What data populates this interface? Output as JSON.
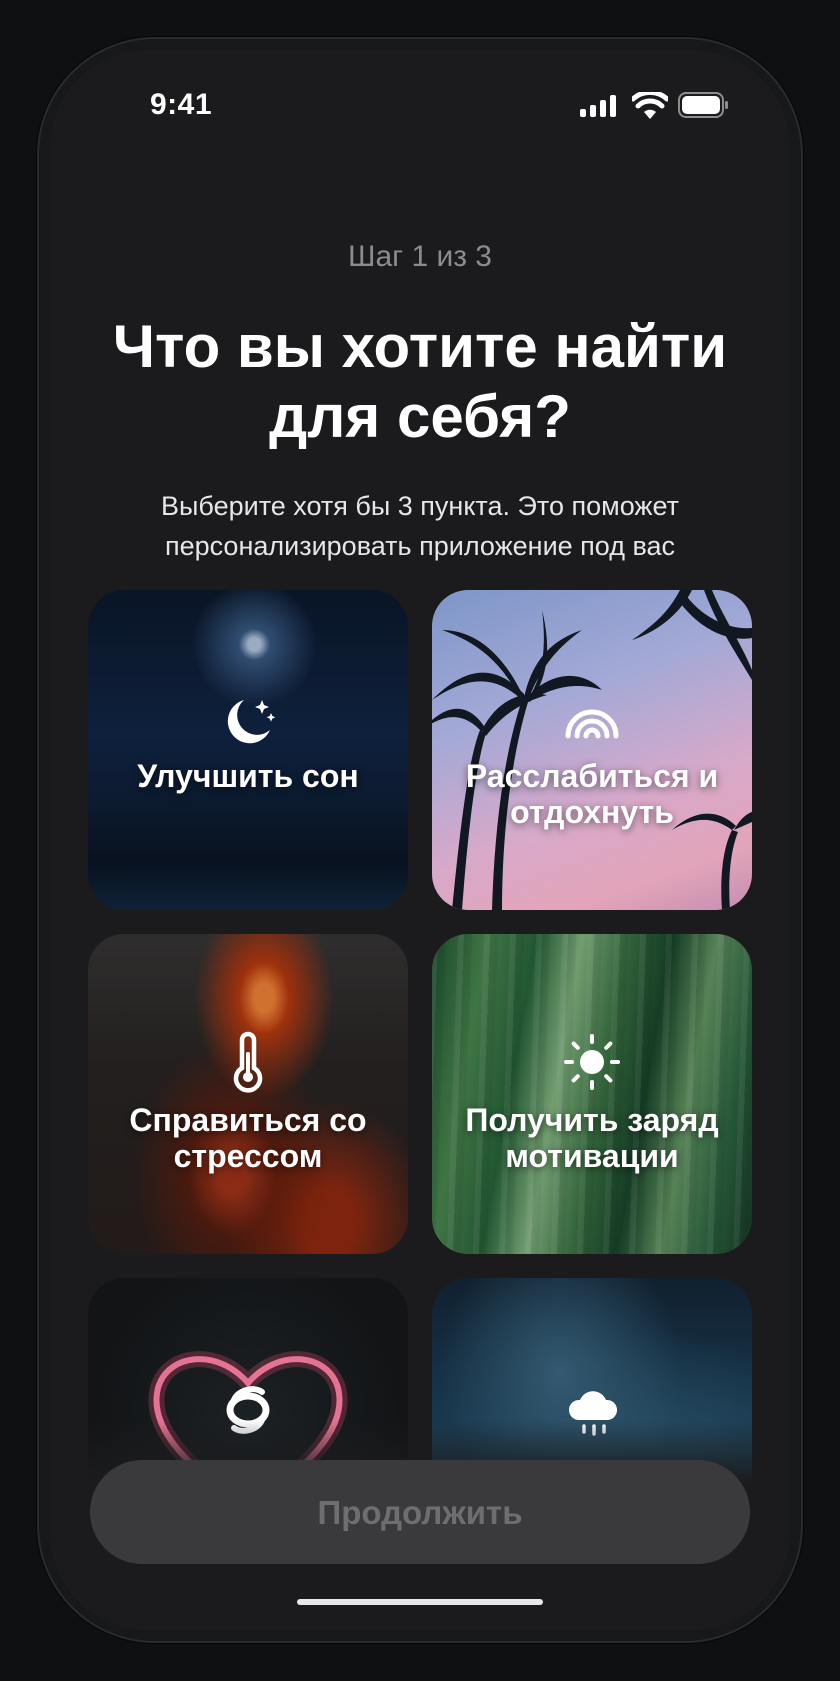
{
  "status_bar": {
    "time": "9:41"
  },
  "onboarding": {
    "step_label": "Шаг 1 из 3",
    "title": "Что вы хотите найти для себя?",
    "subtitle": "Выберите хотя бы 3 пункта. Это поможет персонализировать приложение под вас"
  },
  "goals": [
    {
      "label": "Улучшить сон",
      "icon": "moon-stars-icon"
    },
    {
      "label": "Расслабиться и отдохнуть",
      "icon": "rainbow-icon"
    },
    {
      "label": "Справиться со стрессом",
      "icon": "thermometer-icon"
    },
    {
      "label": "Получить заряд мотивации",
      "icon": "sun-icon"
    },
    {
      "label": "",
      "icon": "swirl-icon"
    },
    {
      "label": "",
      "icon": "cloud-rain-icon"
    }
  ],
  "continue_button": {
    "label": "Продолжить",
    "enabled": false
  },
  "colors": {
    "background": "#0f1011",
    "screen": "#1b1b1d",
    "button_disabled": "#3a3a3c",
    "button_text_disabled": "#6e6e72"
  }
}
